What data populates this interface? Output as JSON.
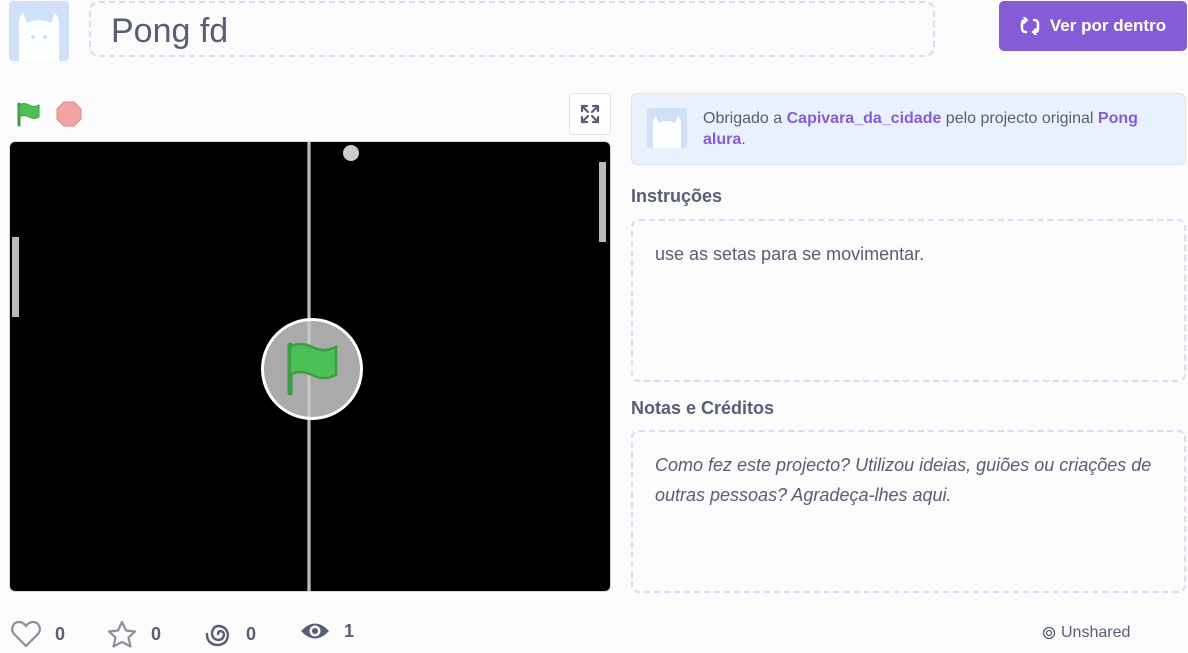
{
  "project": {
    "title": "Pong fd",
    "remix_label": "Ver por dentro"
  },
  "credit": {
    "prefix": "Obrigado a ",
    "author": "Capivara_da_cidade",
    "middle": " pelo projecto original ",
    "original_project": "Pong alura",
    "suffix": "."
  },
  "instructions": {
    "heading": "Instruções",
    "text": "use as setas para se movimentar."
  },
  "notes": {
    "heading": "Notas e Créditos",
    "placeholder": "Como fez este projecto? Utilizou ideias, guiões ou criações de outras pessoas? Agradeça-lhes aqui."
  },
  "stats": {
    "loves": "0",
    "favorites": "0",
    "remixes": "0",
    "views": "1"
  },
  "status": {
    "label": "Unshared"
  },
  "icons": {
    "avatar": "scratch-cat-avatar",
    "remix": "remix-icon",
    "green_flag": "green-flag-icon",
    "stop": "stop-icon",
    "fullscreen": "fullscreen-icon",
    "love": "heart-icon",
    "favorite": "star-icon",
    "remix_count": "spiral-icon",
    "views": "eye-icon"
  },
  "colors": {
    "accent": "#855cd6",
    "green_flag": "#4cbf56",
    "stop": "#ec9c9c",
    "dashed_border": "#cfe0f7",
    "credit_bg": "#e9f1fc"
  }
}
